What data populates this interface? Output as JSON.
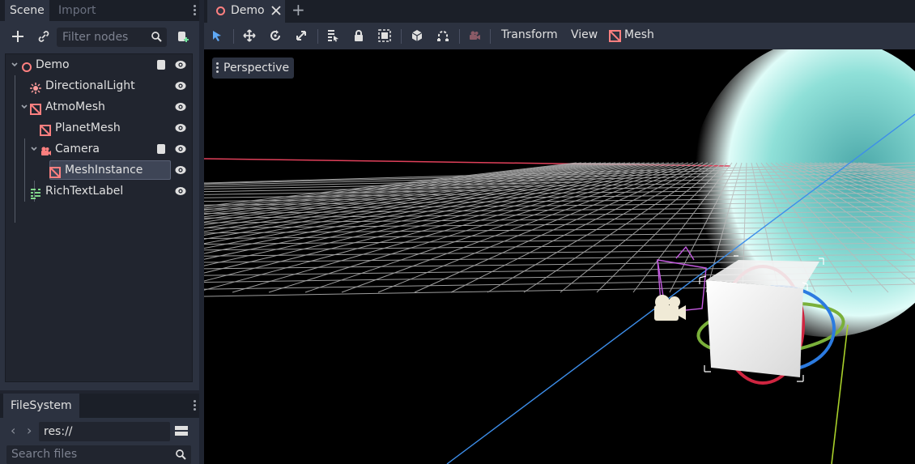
{
  "scene_dock": {
    "tabs": [
      "Scene",
      "Import"
    ],
    "filter_placeholder": "Filter nodes",
    "tree": [
      {
        "label": "Demo",
        "icon": "scene-root-icon"
      },
      {
        "label": "DirectionalLight",
        "icon": "light-icon"
      },
      {
        "label": "AtmoMesh",
        "icon": "mesh-icon"
      },
      {
        "label": "PlanetMesh",
        "icon": "mesh-icon"
      },
      {
        "label": "Camera",
        "icon": "camera-icon"
      },
      {
        "label": "MeshInstance",
        "icon": "mesh-icon"
      },
      {
        "label": "RichTextLabel",
        "icon": "richtext-icon"
      }
    ]
  },
  "filesystem_dock": {
    "tab": "FileSystem",
    "path": "res://",
    "search_placeholder": "Search files"
  },
  "editor": {
    "scene_tab": "Demo",
    "viewport_menus": {
      "transform": "Transform",
      "view": "View",
      "mesh": "Mesh"
    },
    "perspective_label": "Perspective"
  },
  "colors": {
    "accent_red": "#ff8080",
    "eye_white": "#e0e0e0",
    "selection_bg": "#3e4556",
    "atmosphere_cyan": "#8fe0d8"
  }
}
